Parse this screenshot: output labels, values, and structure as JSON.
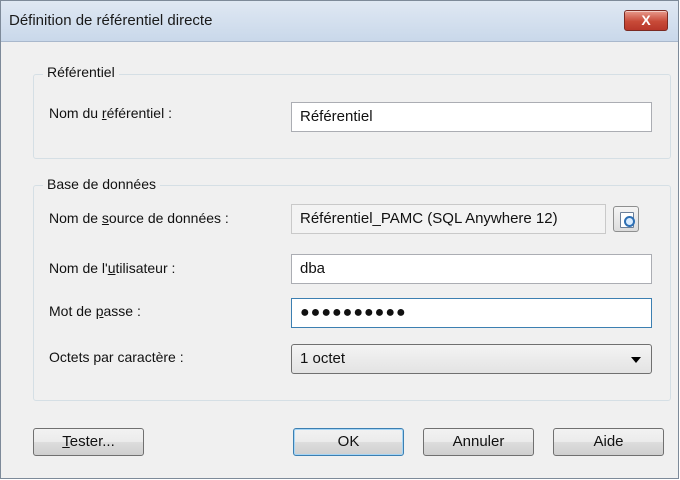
{
  "window": {
    "title": "Définition de référentiel directe",
    "close_glyph": "X"
  },
  "group_repository": {
    "legend": "Référentiel",
    "name_label_pre": "Nom du ",
    "name_label_key": "r",
    "name_label_post": "éférentiel :",
    "name_value": "Référentiel"
  },
  "group_database": {
    "legend": "Base de données",
    "dsn_label_pre": "Nom de ",
    "dsn_label_key": "s",
    "dsn_label_post": "ource de données :",
    "dsn_value": "Référentiel_PAMC (SQL Anywhere 12)",
    "user_label_pre": "Nom de l'",
    "user_label_key": "u",
    "user_label_post": "tilisateur :",
    "user_value": "dba",
    "password_label_pre": "Mot de ",
    "password_label_key": "p",
    "password_label_post": "asse :",
    "password_value": "●●●●●●●●●●",
    "bytes_label": "Octets par caractère :",
    "bytes_value": "1 octet"
  },
  "buttons": {
    "test_key": "T",
    "test_rest": "ester...",
    "ok": "OK",
    "cancel": "Annuler",
    "help": "Aide"
  }
}
